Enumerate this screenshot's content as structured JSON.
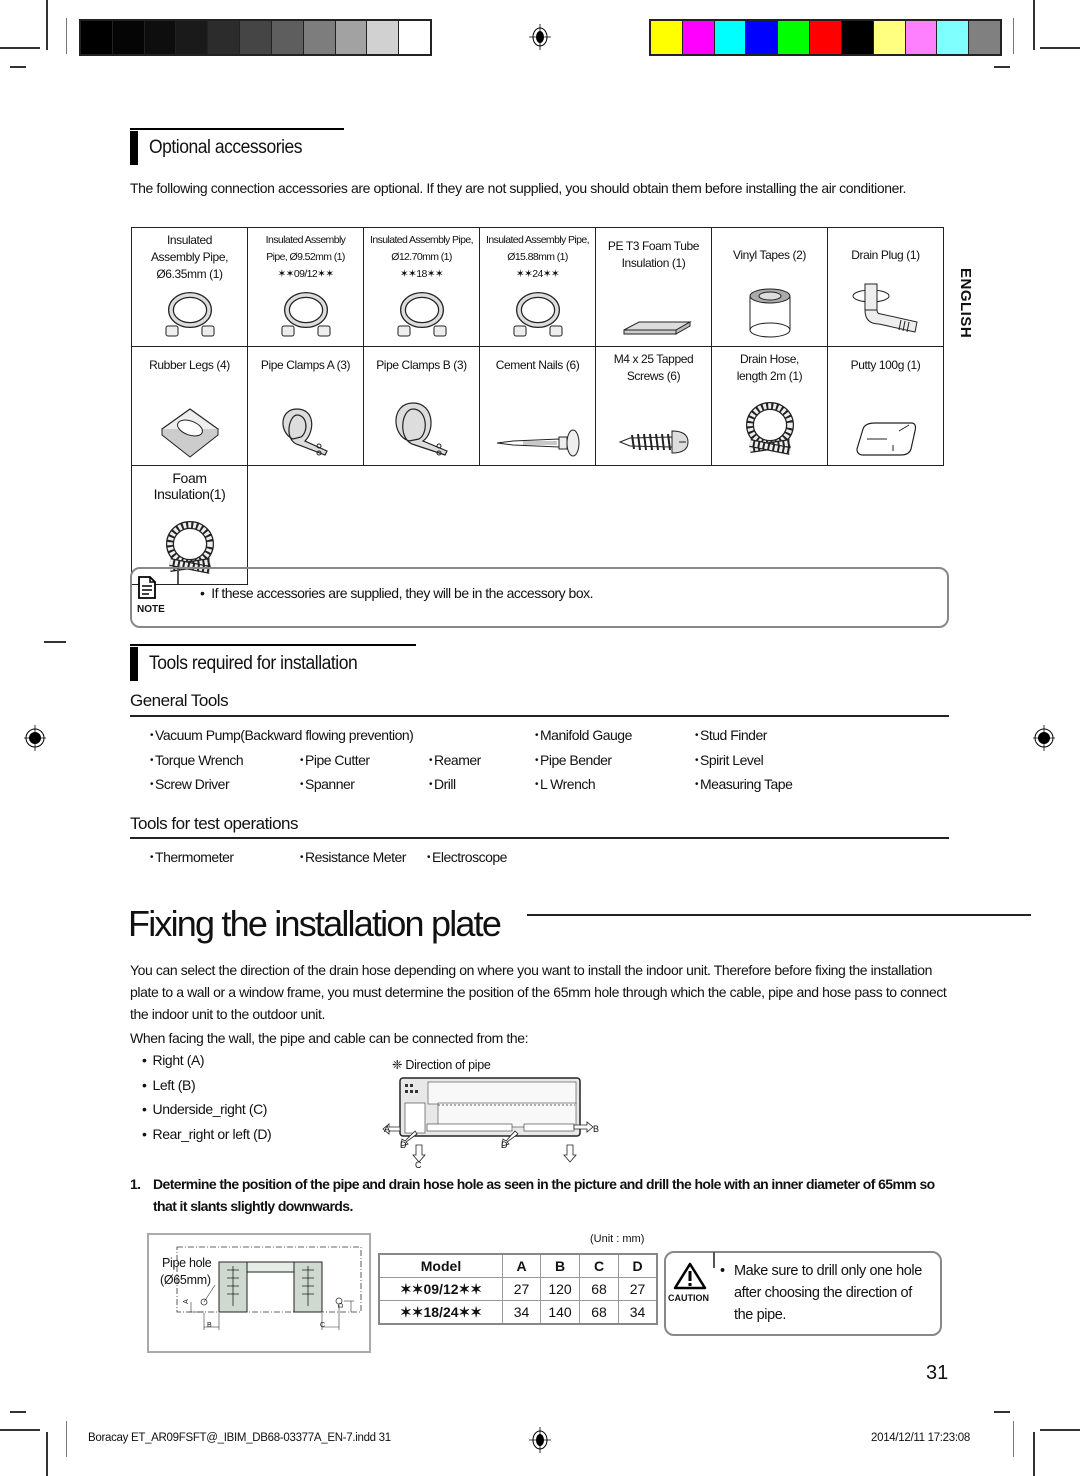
{
  "print_marks": {
    "gray_swatches": [
      "#000000",
      "#050505",
      "#0e0e0e",
      "#1a1a1a",
      "#2c2c2c",
      "#454545",
      "#5e5e5e",
      "#7d7d7d",
      "#a2a2a2",
      "#d1d1d1",
      "#ffffff"
    ],
    "color_swatches": [
      "#ffff00",
      "#ff00ff",
      "#00ffff",
      "#0000ff",
      "#00ff00",
      "#ff0000",
      "#000000",
      "#ffff80",
      "#ff80ff",
      "#80ffff",
      "#808080"
    ]
  },
  "optional_accessories": {
    "heading": "Optional accessories",
    "intro": "The following connection accessories are optional. If they are not supplied, you should obtain them before installing the air conditioner.",
    "side_label": "ENGLISH",
    "items": [
      {
        "label": "Insulated Assembly Pipe, Ø6.35mm (1)",
        "icon": "pipe-coil-icon"
      },
      {
        "label": "Insulated Assembly Pipe, Ø9.52mm (1) ✶✶09/12✶✶",
        "icon": "pipe-coil-icon"
      },
      {
        "label": "Insulated Assembly Pipe, Ø12.70mm (1) ✶✶18✶✶",
        "icon": "pipe-coil-icon"
      },
      {
        "label": "Insulated Assembly Pipe, Ø15.88mm (1) ✶✶24✶✶",
        "icon": "pipe-coil-icon"
      },
      {
        "label": "PE T3 Foam Tube Insulation (1)",
        "icon": "foam-sheet-icon"
      },
      {
        "label": "Vinyl Tapes (2)",
        "icon": "tape-roll-icon"
      },
      {
        "label": "Drain Plug (1)",
        "icon": "drain-plug-icon"
      },
      {
        "label": "Rubber Legs (4)",
        "icon": "rubber-leg-icon"
      },
      {
        "label": "Pipe Clamps A (3)",
        "icon": "pipe-clamp-icon"
      },
      {
        "label": "Pipe Clamps B (3)",
        "icon": "pipe-clamp-icon"
      },
      {
        "label": "Cement Nails (6)",
        "icon": "nail-icon"
      },
      {
        "label": "M4 x 25 Tapped Screws (6)",
        "icon": "screw-icon"
      },
      {
        "label": "Drain Hose, length 2m (1)",
        "icon": "drain-hose-icon"
      },
      {
        "label": "Putty 100g (1)",
        "icon": "putty-icon"
      },
      {
        "label": "Foam Insulation(1)",
        "icon": "foam-coil-icon"
      }
    ],
    "cells": {
      "c0": [
        "Insulated",
        "Assembly Pipe,",
        "Ø6.35mm (1)"
      ],
      "c1": [
        "Insulated Assembly",
        "Pipe, Ø9.52mm (1)",
        "✶✶09/12✶✶"
      ],
      "c2": [
        "Insulated Assembly Pipe,",
        "Ø12.70mm (1)",
        "✶✶18✶✶"
      ],
      "c3": [
        "Insulated Assembly Pipe,",
        "Ø15.88mm (1)",
        "✶✶24✶✶"
      ],
      "c4": [
        "PE T3 Foam Tube",
        "Insulation (1)"
      ],
      "c5": [
        "Vinyl Tapes (2)"
      ],
      "c6": [
        "Drain Plug (1)"
      ],
      "c7": [
        "Rubber Legs (4)"
      ],
      "c8": [
        "Pipe Clamps A (3)"
      ],
      "c9": [
        "Pipe Clamps B (3)"
      ],
      "c10": [
        "Cement Nails (6)"
      ],
      "c11": [
        "M4 x 25 Tapped",
        "Screws (6)"
      ],
      "c12": [
        "Drain Hose,",
        "length 2m (1)"
      ],
      "c13": [
        "Putty 100g (1)"
      ],
      "c14": [
        "Foam",
        "Insulation(1)"
      ]
    },
    "note": {
      "label": "NOTE",
      "text": "If these accessories are supplied, they will be in the accessory box."
    }
  },
  "tools": {
    "heading": "Tools required for installation",
    "general_heading": "General Tools",
    "general": [
      "Vacuum Pump(Backward flowing prevention)",
      "Manifold Gauge",
      "Stud Finder",
      "Torque Wrench",
      "Pipe Cutter",
      "Reamer",
      "Pipe Bender",
      "Spirit Level",
      "Screw Driver",
      "Spanner",
      "Drill",
      "L Wrench",
      "Measuring Tape"
    ],
    "test_heading": "Tools for test operations",
    "test": [
      "Thermometer",
      "Resistance Meter",
      "Electroscope"
    ]
  },
  "fixing": {
    "title": "Fixing the installation plate",
    "para1": "You can select the direction of the drain hose depending on where you want to install the indoor unit. Therefore before fixing the installation plate to a wall or a window frame, you must determine the position of the 65mm hole through which the cable, pipe and hose pass to connect the indoor unit to the outdoor unit.",
    "para2": "When facing the wall, the pipe and cable can be connected from the:",
    "directions": [
      "Right (A)",
      "Left (B)",
      "Underside_right (C)",
      "Rear_right or left (D)"
    ],
    "diagram_caption": "❈ Direction of pipe",
    "diagram_labels": {
      "a": "A",
      "b": "B",
      "c": "C",
      "d": "D"
    },
    "step_num": "1.",
    "step_text": "Determine the position of the pipe and drain hose hole as seen in the picture and drill the hole with an inner diameter of 65mm so that it slants slightly downwards.",
    "plate_diagram": {
      "pipe_hole": "Pipe hole",
      "diameter": "(Ø65mm)",
      "a": "A",
      "b": "B",
      "c": "C",
      "d": "D"
    },
    "unit_label": "(Unit : mm)",
    "dim_table": {
      "headers": [
        "Model",
        "A",
        "B",
        "C",
        "D"
      ],
      "rows": [
        [
          "✶✶09/12✶✶",
          "27",
          "120",
          "68",
          "27"
        ],
        [
          "✶✶18/24✶✶",
          "34",
          "140",
          "68",
          "34"
        ]
      ]
    },
    "caution": {
      "label": "CAUTION",
      "text": "Make sure to drill only one hole after choosing the direction of the pipe."
    }
  },
  "page_number": "31",
  "footer": {
    "file": "Boracay ET_AR09FSFT@_IBIM_DB68-03377A_EN-7.indd   31",
    "timestamp": "2014/12/11   17:23:08"
  }
}
